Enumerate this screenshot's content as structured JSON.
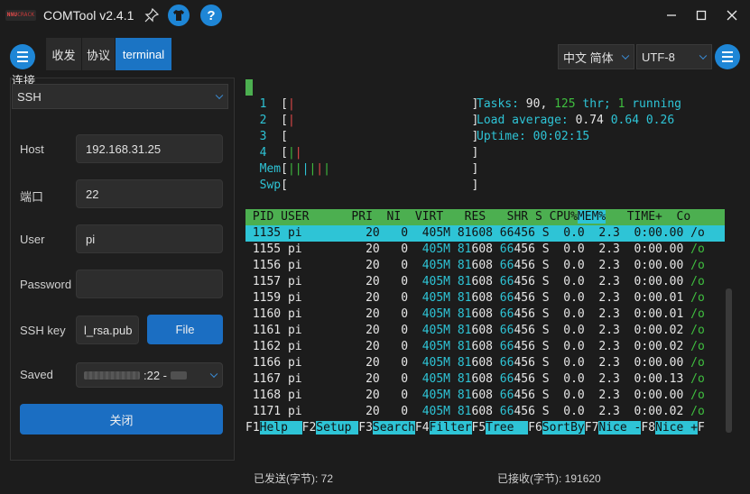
{
  "app": {
    "logo_text_top": "NNU",
    "logo_text_bottom": "CRACK",
    "title": "COMTool v2.4.1"
  },
  "toolbar": {
    "tabs": [
      {
        "label": "收发",
        "active": false
      },
      {
        "label": "协议",
        "active": false
      },
      {
        "label": "terminal",
        "active": true
      }
    ],
    "language": "中文 简体",
    "encoding": "UTF-8",
    "accent_color": "#1e86d6"
  },
  "left": {
    "section_label": "连接",
    "protocol": "SSH",
    "host_label": "Host",
    "host_value": "192.168.31.25",
    "port_label": "端口",
    "port_value": "22",
    "user_label": "User",
    "user_value": "pi",
    "password_label": "Password",
    "password_value": "",
    "sshkey_label": "SSH key",
    "sshkey_value": "l_rsa.pub",
    "file_button": "File",
    "saved_label": "Saved",
    "saved_value": ":22 -",
    "close_button": "关闭"
  },
  "terminal": {
    "cpu_bars": [
      {
        "num": "1",
        "bars": [
          {
            "t": "|",
            "c": "r"
          }
        ]
      },
      {
        "num": "2",
        "bars": [
          {
            "t": "|",
            "c": "r"
          }
        ]
      },
      {
        "num": "3",
        "bars": []
      },
      {
        "num": "4",
        "bars": [
          {
            "t": "|",
            "c": "g"
          },
          {
            "t": "|",
            "c": "r"
          }
        ]
      }
    ],
    "mem_label": "Mem",
    "mem_bars": "||||||",
    "swp_label": "Swp",
    "tasks_label": "Tasks: ",
    "tasks_value": "90, ",
    "thr_value": "125",
    "thr_label": " thr; ",
    "running_value": "1",
    "running_label": " running",
    "load_label": "Load average: ",
    "load_1": "0.74",
    "load_5": "0.64",
    "load_15": "0.26",
    "uptime_label": "Uptime: ",
    "uptime_value": "00:02:15",
    "columns": [
      " PID",
      " USER",
      "      PRI",
      "  NI",
      "  VIRT",
      "   RES",
      "   SHR",
      " S",
      " CPU%",
      "MEM%",
      "   TIME+",
      "  Co"
    ],
    "processes": [
      {
        "pid": "1135",
        "user": "pi",
        "pri": "20",
        "ni": "0",
        "virt": "405M",
        "res": "81608",
        "shr": "66456",
        "s": "S",
        "cpu": "0.0",
        "mem": "2.3",
        "time": "0:00.00",
        "cmd": "/o"
      },
      {
        "pid": "1155",
        "user": "pi",
        "pri": "20",
        "ni": "0",
        "virt": "405M",
        "res": "81608",
        "shr": "66456",
        "s": "S",
        "cpu": "0.0",
        "mem": "2.3",
        "time": "0:00.00",
        "cmd": "/o"
      },
      {
        "pid": "1156",
        "user": "pi",
        "pri": "20",
        "ni": "0",
        "virt": "405M",
        "res": "81608",
        "shr": "66456",
        "s": "S",
        "cpu": "0.0",
        "mem": "2.3",
        "time": "0:00.00",
        "cmd": "/o"
      },
      {
        "pid": "1157",
        "user": "pi",
        "pri": "20",
        "ni": "0",
        "virt": "405M",
        "res": "81608",
        "shr": "66456",
        "s": "S",
        "cpu": "0.0",
        "mem": "2.3",
        "time": "0:00.00",
        "cmd": "/o"
      },
      {
        "pid": "1159",
        "user": "pi",
        "pri": "20",
        "ni": "0",
        "virt": "405M",
        "res": "81608",
        "shr": "66456",
        "s": "S",
        "cpu": "0.0",
        "mem": "2.3",
        "time": "0:00.01",
        "cmd": "/o"
      },
      {
        "pid": "1160",
        "user": "pi",
        "pri": "20",
        "ni": "0",
        "virt": "405M",
        "res": "81608",
        "shr": "66456",
        "s": "S",
        "cpu": "0.0",
        "mem": "2.3",
        "time": "0:00.01",
        "cmd": "/o"
      },
      {
        "pid": "1161",
        "user": "pi",
        "pri": "20",
        "ni": "0",
        "virt": "405M",
        "res": "81608",
        "shr": "66456",
        "s": "S",
        "cpu": "0.0",
        "mem": "2.3",
        "time": "0:00.02",
        "cmd": "/o"
      },
      {
        "pid": "1162",
        "user": "pi",
        "pri": "20",
        "ni": "0",
        "virt": "405M",
        "res": "81608",
        "shr": "66456",
        "s": "S",
        "cpu": "0.0",
        "mem": "2.3",
        "time": "0:00.02",
        "cmd": "/o"
      },
      {
        "pid": "1166",
        "user": "pi",
        "pri": "20",
        "ni": "0",
        "virt": "405M",
        "res": "81608",
        "shr": "66456",
        "s": "S",
        "cpu": "0.0",
        "mem": "2.3",
        "time": "0:00.00",
        "cmd": "/o"
      },
      {
        "pid": "1167",
        "user": "pi",
        "pri": "20",
        "ni": "0",
        "virt": "405M",
        "res": "81608",
        "shr": "66456",
        "s": "S",
        "cpu": "0.0",
        "mem": "2.3",
        "time": "0:00.13",
        "cmd": "/o"
      },
      {
        "pid": "1168",
        "user": "pi",
        "pri": "20",
        "ni": "0",
        "virt": "405M",
        "res": "81608",
        "shr": "66456",
        "s": "S",
        "cpu": "0.0",
        "mem": "2.3",
        "time": "0:00.00",
        "cmd": "/o"
      },
      {
        "pid": "1171",
        "user": "pi",
        "pri": "20",
        "ni": "0",
        "virt": "405M",
        "res": "81608",
        "shr": "66456",
        "s": "S",
        "cpu": "0.0",
        "mem": "2.3",
        "time": "0:00.02",
        "cmd": "/o"
      }
    ],
    "fkeys": [
      {
        "key": "F1",
        "label": "Help  "
      },
      {
        "key": "F2",
        "label": "Setup "
      },
      {
        "key": "F3",
        "label": "Search"
      },
      {
        "key": "F4",
        "label": "Filter"
      },
      {
        "key": "F5",
        "label": "Tree  "
      },
      {
        "key": "F6",
        "label": "SortBy"
      },
      {
        "key": "F7",
        "label": "Nice -"
      },
      {
        "key": "F8",
        "label": "Nice +"
      },
      {
        "key": "F",
        "label": ""
      }
    ],
    "green": "#4caf50",
    "cyan": "#2ec4d6"
  },
  "status": {
    "sent_label": "已发送(字节): ",
    "sent_value": "72",
    "received_label": "已接收(字节): ",
    "received_value": "191620"
  }
}
